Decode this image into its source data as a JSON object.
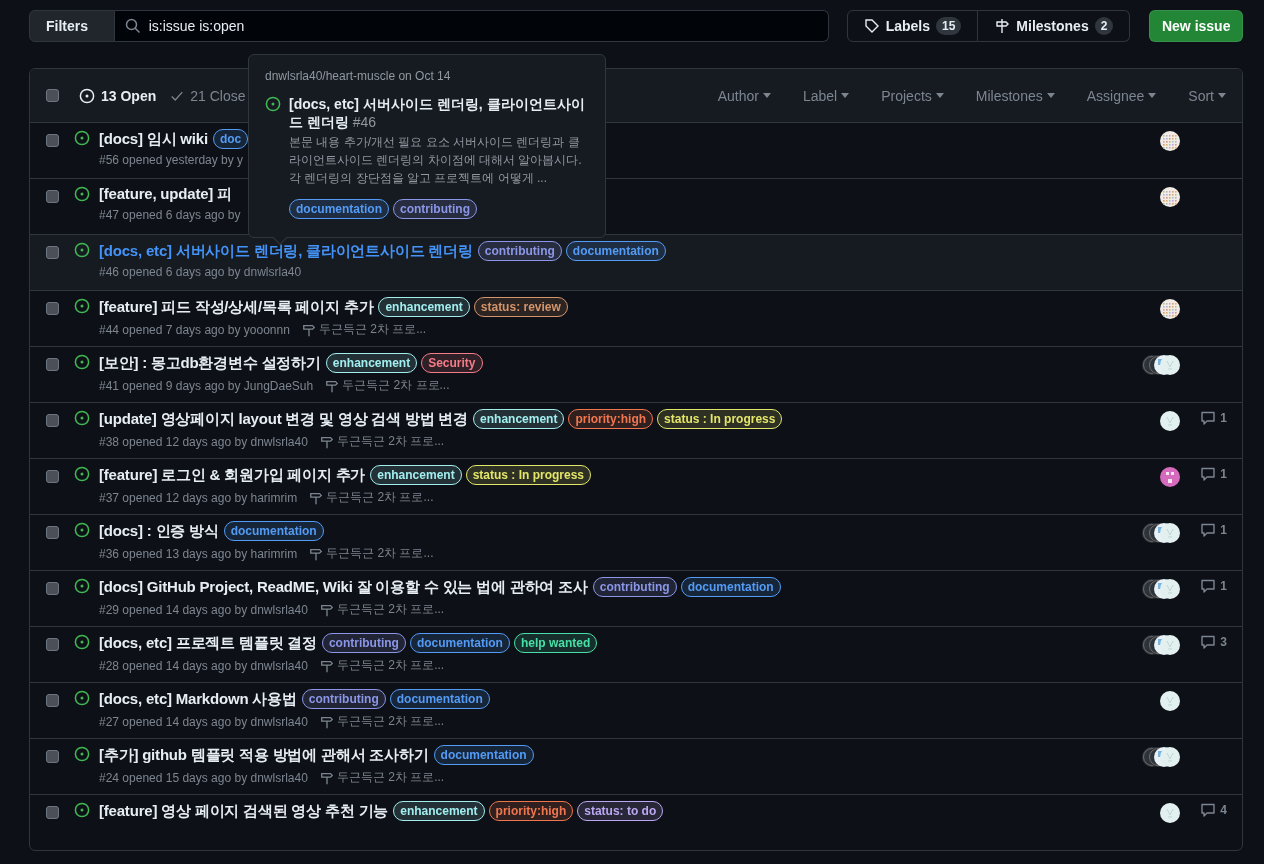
{
  "toolbar": {
    "filters_button": "Filters",
    "search": {
      "value": "is:issue is:open"
    },
    "labels_button": {
      "label": "Labels",
      "count": "15"
    },
    "milestones_button": {
      "label": "Milestones",
      "count": "2"
    },
    "new_button": "New issue"
  },
  "header": {
    "checked": false,
    "tabs": [
      {
        "label": "13 Open",
        "selected": true
      },
      {
        "label": "21 Close",
        "selected": false
      }
    ],
    "filters": [
      "Author",
      "Label",
      "Projects",
      "Milestones",
      "Assignee",
      "Sort"
    ]
  },
  "issues": [
    {
      "title": "[docs] 임시 wiki",
      "checked": false,
      "selected": false,
      "labels": [
        {
          "name": "doc",
          "color": "#539bf5"
        }
      ],
      "meta": "#56 opened yesterday by y",
      "assignees": [
        {
          "kind": "tiled"
        }
      ]
    },
    {
      "title": "[feature, update] 피",
      "checked": false,
      "selected": false,
      "meta": "#47 opened 6 days ago by",
      "assignees": [
        {
          "kind": "tiled"
        }
      ]
    },
    {
      "title": "[docs, etc] 서버사이드 렌더링, 클라이언트사이드 렌더링",
      "checked": false,
      "selected": true,
      "labels": [
        {
          "name": "contributing",
          "color": "#8b96e6"
        },
        {
          "name": "documentation",
          "color": "#539bf5"
        }
      ],
      "meta": "#46 opened 6 days ago by dnwlsrla40"
    },
    {
      "title": "[feature] 피드 작성/상세/목록 페이지 추가",
      "checked": false,
      "selected": false,
      "labels": [
        {
          "name": "enhancement",
          "color": "#a2eeef"
        },
        {
          "name": "status: review",
          "color": "#d4956b"
        }
      ],
      "meta": "#44 opened 7 days ago by yooonnn",
      "milestone": "두근득근 2차 프로...",
      "assignees": [
        {
          "kind": "tiled"
        }
      ]
    },
    {
      "title": "[보안] : 몽고db환경변수 설정하기",
      "checked": false,
      "selected": false,
      "labels": [
        {
          "name": "enhancement",
          "color": "#a2eeef"
        },
        {
          "name": "Security",
          "color": "#f47b88"
        }
      ],
      "meta": "#41 opened 9 days ago by JungDaeSuh",
      "milestone": "두근득근 2차 프로...",
      "assignees": [
        {
          "kind": "dark"
        },
        {
          "kind": "dark"
        },
        {
          "kind": "checked"
        },
        {
          "kind": "light"
        }
      ]
    },
    {
      "title": "[update] 영상페이지 layout 변경 및 영상 검색 방법 변경",
      "checked": false,
      "selected": false,
      "labels": [
        {
          "name": "enhancement",
          "color": "#a2eeef"
        },
        {
          "name": "priority:high",
          "color": "#f0764f"
        },
        {
          "name": "status : In progress",
          "color": "#e4e669"
        }
      ],
      "meta": "#38 opened 12 days ago by dnwlsrla40",
      "milestone": "두근득근 2차 프로...",
      "assignees": [
        {
          "kind": "light"
        }
      ],
      "comments": "1"
    },
    {
      "title": "[feature] 로그인 & 회원가입 페이지 추가",
      "checked": false,
      "selected": false,
      "labels": [
        {
          "name": "enhancement",
          "color": "#a2eeef"
        },
        {
          "name": "status : In progress",
          "color": "#e4e669"
        }
      ],
      "meta": "#37 opened 12 days ago by harimrim",
      "milestone": "두근득근 2차 프로...",
      "assignees": [
        {
          "kind": "pink"
        }
      ],
      "comments": "1"
    },
    {
      "title": "[docs] : 인증 방식",
      "checked": false,
      "selected": false,
      "labels": [
        {
          "name": "documentation",
          "color": "#539bf5"
        }
      ],
      "meta": "#36 opened 13 days ago by harimrim",
      "milestone": "두근득근 2차 프로...",
      "assignees": [
        {
          "kind": "dark"
        },
        {
          "kind": "dark"
        },
        {
          "kind": "checked"
        },
        {
          "kind": "light"
        }
      ],
      "comments": "1"
    },
    {
      "title": "[docs] GitHub Project, ReadME, Wiki 잘 이용할 수 있는 법에 관하여 조사",
      "checked": false,
      "selected": false,
      "labels": [
        {
          "name": "contributing",
          "color": "#8b96e6"
        },
        {
          "name": "documentation",
          "color": "#539bf5"
        }
      ],
      "meta": "#29 opened 14 days ago by dnwlsrla40",
      "milestone": "두근득근 2차 프로...",
      "assignees": [
        {
          "kind": "dark"
        },
        {
          "kind": "dark"
        },
        {
          "kind": "checked"
        },
        {
          "kind": "light"
        }
      ],
      "comments": "1"
    },
    {
      "title": "[docs, etc] 프로젝트 템플릿 결정",
      "checked": false,
      "selected": false,
      "labels": [
        {
          "name": "contributing",
          "color": "#8b96e6"
        },
        {
          "name": "documentation",
          "color": "#539bf5"
        },
        {
          "name": "help wanted",
          "color": "#48e0a6"
        }
      ],
      "meta": "#28 opened 14 days ago by dnwlsrla40",
      "milestone": "두근득근 2차 프로...",
      "assignees": [
        {
          "kind": "dark"
        },
        {
          "kind": "dark"
        },
        {
          "kind": "checked"
        },
        {
          "kind": "light"
        }
      ],
      "comments": "3"
    },
    {
      "title": "[docs, etc] Markdown 사용법",
      "checked": false,
      "selected": false,
      "labels": [
        {
          "name": "contributing",
          "color": "#8b96e6"
        },
        {
          "name": "documentation",
          "color": "#539bf5"
        }
      ],
      "meta": "#27 opened 14 days ago by dnwlsrla40",
      "milestone": "두근득근 2차 프로...",
      "assignees": [
        {
          "kind": "light"
        }
      ]
    },
    {
      "title": "[추가] github 템플릿 적용 방법에 관해서 조사하기",
      "checked": false,
      "selected": false,
      "labels": [
        {
          "name": "documentation",
          "color": "#539bf5"
        }
      ],
      "meta": "#24 opened 15 days ago by dnwlsrla40",
      "milestone": "두근득근 2차 프로...",
      "assignees": [
        {
          "kind": "dark"
        },
        {
          "kind": "dark"
        },
        {
          "kind": "checked"
        },
        {
          "kind": "light"
        }
      ]
    },
    {
      "title": "[feature] 영상 페이지 검색된 영상 추천 기능",
      "checked": false,
      "selected": false,
      "labels": [
        {
          "name": "enhancement",
          "color": "#a2eeef"
        },
        {
          "name": "priority:high",
          "color": "#f0764f"
        },
        {
          "name": "status: to do",
          "color": "#bba7f2"
        }
      ],
      "assignees": [
        {
          "kind": "light"
        }
      ],
      "comments": "4"
    }
  ],
  "hovercard": {
    "context": "dnwlsrla40/heart-muscle on Oct 14",
    "title": "[docs, etc] 서버사이드 렌더링, 클라이언트사이드 렌더링",
    "number": "#46",
    "body": "본문 내용 추가/개선 필요 요소 서버사이드 렌더링과 클라이언트사이드 렌더링의 차이점에 대해서 알아봅시다. 각 렌더링의 장단점을 알고 프로젝트에 어떻게 ...",
    "labels": [
      {
        "name": "documentation",
        "color": "#539bf5"
      },
      {
        "name": "contributing",
        "color": "#8b96e6"
      }
    ]
  }
}
